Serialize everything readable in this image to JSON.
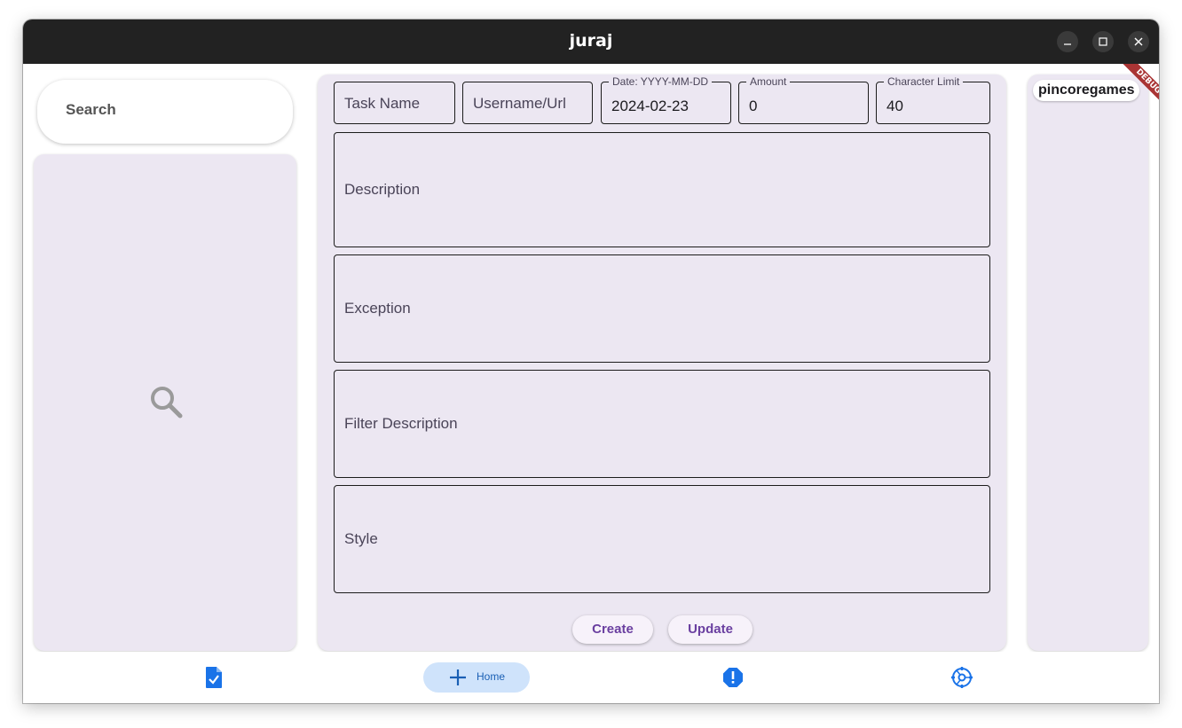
{
  "window": {
    "title": "juraj"
  },
  "search": {
    "label": "Search"
  },
  "form": {
    "task_name_placeholder": "Task Name",
    "username_placeholder": "Username/Url",
    "date_label": "Date: YYYY-MM-DD",
    "date_value": "2024-02-23",
    "amount_label": "Amount",
    "amount_value": "0",
    "char_limit_label": "Character Limit",
    "char_limit_value": "40",
    "description_placeholder": "Description",
    "exception_placeholder": "Exception",
    "filter_description_placeholder": "Filter Description",
    "style_placeholder": "Style"
  },
  "actions": {
    "create_label": "Create",
    "update_label": "Update"
  },
  "right_panel": {
    "chip_label": "pincoregames"
  },
  "debug_banner": "DEBUG",
  "bottom_nav": {
    "items": [
      {
        "icon": "task-check-icon"
      },
      {
        "icon": "plus-icon",
        "label": "Home"
      },
      {
        "icon": "alert-octagon-icon"
      },
      {
        "icon": "settings-icon"
      }
    ]
  },
  "colors": {
    "accent": "#1a73e8",
    "panel": "#ece7f2",
    "button_text": "#6a3fa0",
    "debug": "#a93434"
  }
}
